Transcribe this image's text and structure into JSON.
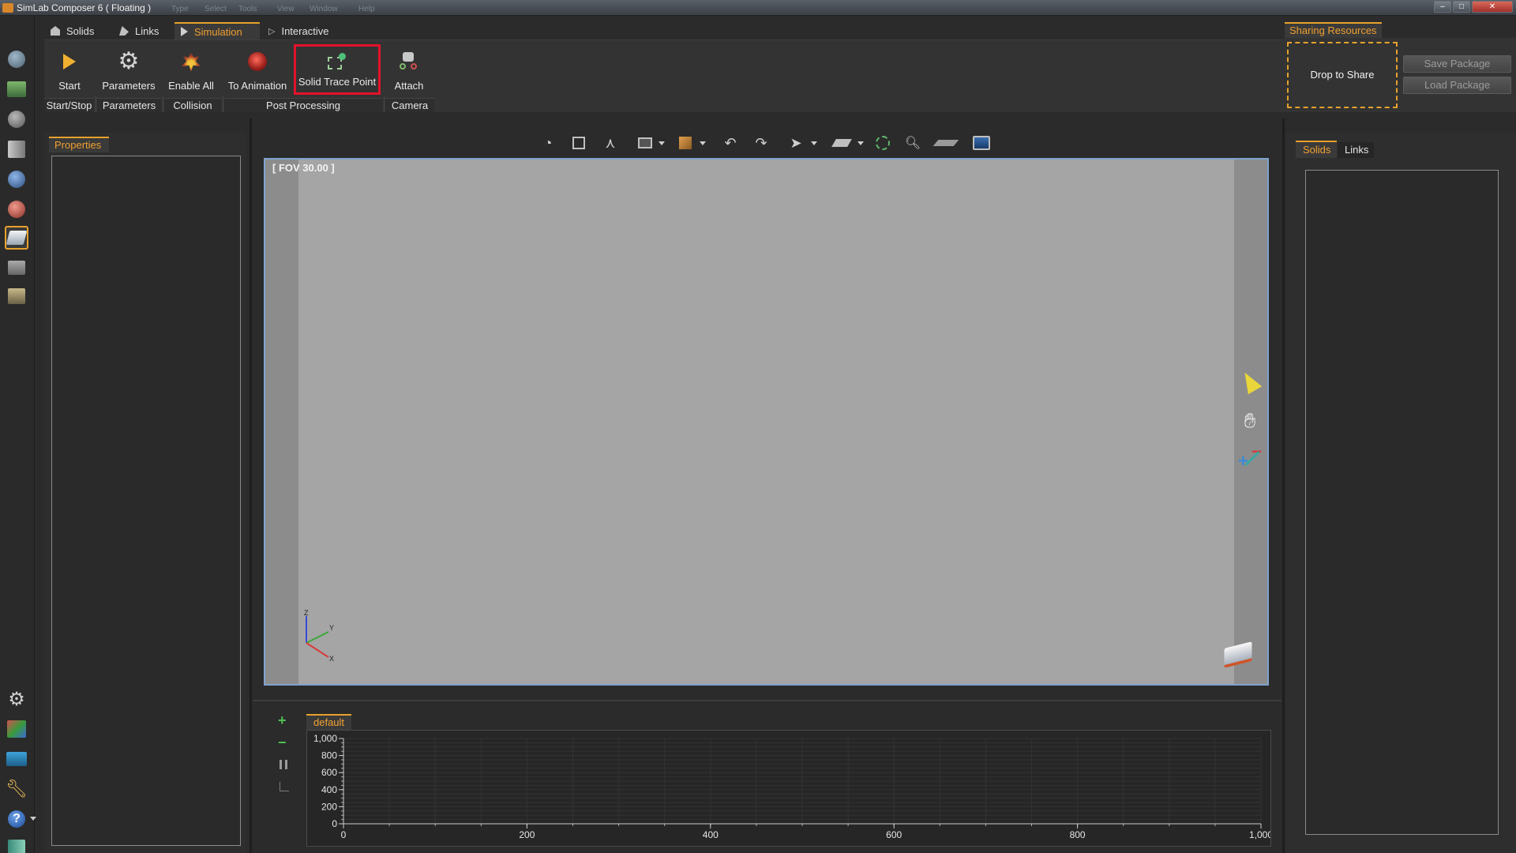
{
  "window": {
    "title": "SimLab Composer 6 ( Floating )",
    "ghost_menu": [
      "Type",
      "Select",
      "Tools",
      "View",
      "Window",
      "Help"
    ]
  },
  "main_tabs": [
    {
      "label": "Solids",
      "icon": "solids-icon",
      "active": false
    },
    {
      "label": "Links",
      "icon": "links-icon",
      "active": false
    },
    {
      "label": "Simulation",
      "icon": "play-icon",
      "active": true
    },
    {
      "label": "Interactive",
      "icon": "play-outline-icon",
      "active": false
    }
  ],
  "ribbon": {
    "buttons": {
      "start": "Start",
      "parameters": "Parameters",
      "enable_all": "Enable All",
      "to_animation": "To Animation",
      "solid_trace_point": "Solid Trace Point",
      "attach": "Attach"
    },
    "groups": {
      "start_stop": "Start/Stop",
      "parameters": "Parameters",
      "collision": "Collision",
      "post_processing": "Post Processing",
      "camera": "Camera"
    }
  },
  "sharing": {
    "tab": "Sharing Resources",
    "drop": "Drop to Share",
    "save": "Save Package",
    "load": "Load Package"
  },
  "left_panel": {
    "tab": "Properties"
  },
  "viewport": {
    "fov": "[ FOV 30.00 ]",
    "axes": {
      "z": "Z",
      "y": "Y",
      "x": "X"
    }
  },
  "graph": {
    "tab": "default",
    "add": "+",
    "remove": "−"
  },
  "right_panel": {
    "tabs": [
      "Solids",
      "Links"
    ]
  },
  "chart_data": {
    "type": "line",
    "title": "",
    "xlabel": "",
    "ylabel": "",
    "xlim": [
      0,
      1000
    ],
    "ylim": [
      0,
      1000
    ],
    "x_ticks": [
      "0",
      "200",
      "400",
      "600",
      "800",
      "1,000"
    ],
    "y_ticks": [
      "0",
      "200",
      "400",
      "600",
      "800",
      "1,000"
    ],
    "series": [],
    "grid": true
  },
  "colors": {
    "accent": "#e8a12c",
    "highlight_border": "#e3122a",
    "viewport_bg": "#a5a5a5",
    "panel_bg": "#2b2b2b"
  }
}
